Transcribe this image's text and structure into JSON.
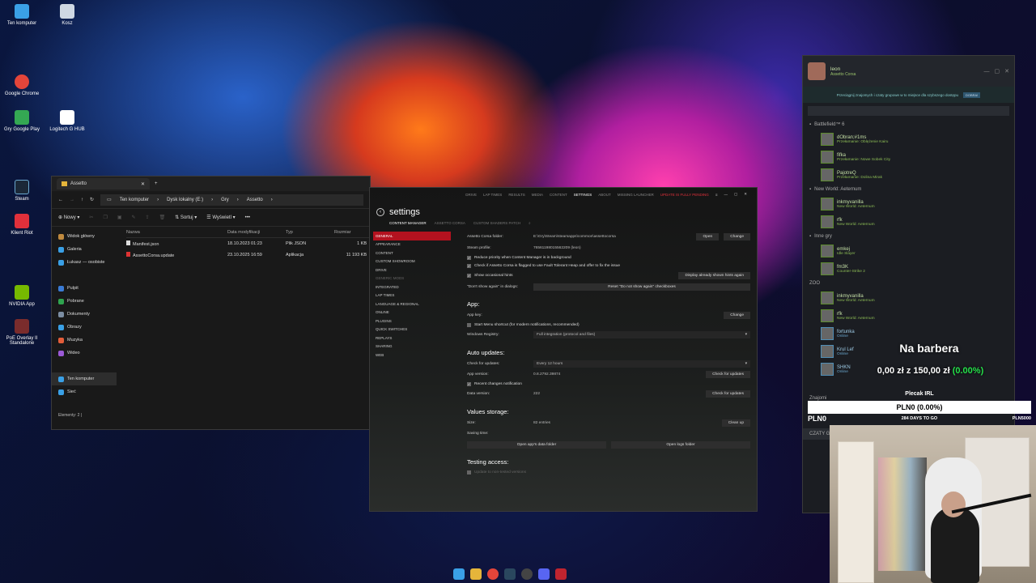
{
  "desktop": {
    "icons": [
      {
        "label": "Ten komputer",
        "color": "#3aa0e6"
      },
      {
        "label": "Kosz",
        "color": "#cfd8e3"
      },
      {
        "label": "Google Chrome",
        "color": "#e3453a"
      },
      {
        "label": "Gry Google Play",
        "color": "#34a853"
      },
      {
        "label": "Logitech G HUB",
        "color": "#ffffff"
      },
      {
        "label": "Steam",
        "color": "#1b2838"
      },
      {
        "label": "Klient Riot",
        "color": "#e0303b"
      },
      {
        "label": "NVIDIA App",
        "color": "#76b900"
      },
      {
        "label": "PoE Overlay II Standalone",
        "color": "#7a2c2c"
      }
    ]
  },
  "explorer": {
    "tab_title": "Assetto",
    "breadcrumbs": [
      "Ten komputer",
      "Dysk lokalny (E:)",
      "Gry",
      "Assetto"
    ],
    "toolbar": {
      "new": "Nowy",
      "sort": "Sortuj",
      "view": "Wyświetl",
      "more": "•••"
    },
    "sidebar": [
      {
        "label": "Widok główny",
        "color": "#c08a3e"
      },
      {
        "label": "Galeria",
        "color": "#3aa0e6"
      },
      {
        "label": "Łukasz — osobiste",
        "color": "#3aa0e6"
      },
      {
        "label": "",
        "color": "transparent"
      },
      {
        "label": "Pulpit",
        "color": "#3a7bd5"
      },
      {
        "label": "Pobrane",
        "color": "#2fa44f"
      },
      {
        "label": "Dokumenty",
        "color": "#7c8ea3"
      },
      {
        "label": "Obrazy",
        "color": "#3aa0e6"
      },
      {
        "label": "Muzyka",
        "color": "#e35d3a"
      },
      {
        "label": "Wideo",
        "color": "#9b59d6"
      },
      {
        "label": "",
        "color": "transparent"
      },
      {
        "label": "Ten komputer",
        "color": "#3aa0e6"
      },
      {
        "label": "Sieć",
        "color": "#3aa0e6"
      }
    ],
    "columns": [
      "Nazwa",
      "Data modyfikacji",
      "Typ",
      "Rozmiar"
    ],
    "files": [
      {
        "name": "Manifest.json",
        "date": "18.10.2023 01:23",
        "type": "Plik JSON",
        "size": "1 KB"
      },
      {
        "name": "AssettoCorsa.update",
        "date": "23.10.2025 16:59",
        "type": "Aplikacja",
        "size": "11 193 KB"
      }
    ],
    "status": "Elementy: 2  |"
  },
  "content_manager": {
    "top_menu": [
      "DRIVE",
      "LAP TIMES",
      "RESULTS",
      "MEDIA",
      "CONTENT",
      "SETTINGS",
      "ABOUT",
      "MISSING LAUNCHER",
      "UPDATE IS FULLY PENDING"
    ],
    "title": "settings",
    "sub_tabs": [
      "CONTENT MANAGER",
      "ASSETTO CORSA",
      "CUSTOM SHADERS PATCH"
    ],
    "nav": [
      "GENERAL",
      "APPEARANCE",
      "CONTENT",
      "CUSTOM SHOWROOM",
      "DRIVE",
      "GENERIC MODS",
      "INTEGRATED",
      "LAP TIMES",
      "LANGUAGE & REGIONAL",
      "ONLINE",
      "PLUGINS",
      "QUICK SWITCHES",
      "REPLAYS",
      "SHARING",
      "WEB"
    ],
    "general": {
      "folder_label": "Assetto Corsa folder:",
      "folder_value": "E:\\Gry\\Steam\\steamapps\\common\\assettocorsa",
      "open": "Open",
      "change": "Change",
      "steam_label": "Steam profile:",
      "steam_value": "76561198015562209 (leon)",
      "check1": "Reduce priority when Content Manager is in background",
      "check2": "Check if Assetto Corsa is flagged to use Fault Tolerant Heap and offer to fix the issue",
      "check3": "Show occasional hints",
      "hints_btn": "Display already shown hints again",
      "dont_show_label": "\"Don't show again\" in dialogs:",
      "reset_btn": "Reset \"Do not show again\" checkboxes"
    },
    "app": {
      "heading": "App:",
      "key_label": "App key:",
      "change": "Change",
      "start_menu": "Start Menu shortcut (for modern notifications, recommended)",
      "registry_label": "Windows Registry:",
      "registry_value": "Full integration (protocol and files)"
    },
    "updates": {
      "heading": "Auto updates:",
      "check_label": "Check for updates:",
      "check_value": "Every 12 hours",
      "version_label": "App version:",
      "version_value": "0.8.2792.39874",
      "check_btn": "Check for updates",
      "recent": "Recent changes notification",
      "data_label": "Data version:",
      "data_value": "222",
      "check_btn2": "Check for updates"
    },
    "storage": {
      "heading": "Values storage:",
      "size_label": "Size:",
      "size_value": "82 entries",
      "cleanup": "Clean up",
      "saving_label": "Saving time:",
      "open_data": "Open app's data folder",
      "open_logs": "Open logs folder"
    },
    "testing": {
      "heading": "Testing access:",
      "update": "Update to non-tested versions"
    }
  },
  "steam": {
    "user": "leon",
    "status": "Assetto Corsa",
    "banner": "Przeciągnij znajomych i czaty grupowe w to miejsce dla szybszego dostępu",
    "banner_btn": "DOBRA!",
    "groups": [
      {
        "title": "Battlefield™ 6",
        "friends": [
          {
            "name": "dObran;#1ms",
            "sub": "Przełamanie: Oblężenie Kairu",
            "kind": "g"
          },
          {
            "name": "fifka",
            "sub": "Przełamanie: Nowe Sobek City",
            "kind": "g"
          },
          {
            "name": "PajotreQ",
            "sub": "Przełamanie: Dolina Mirak",
            "kind": "g"
          }
        ]
      },
      {
        "title": "New World: Aeternum",
        "friends": [
          {
            "name": "inkmyvanilla",
            "sub": "New World: Aeternum",
            "kind": "g"
          },
          {
            "name": "rfk",
            "sub": "New World: Aeternum",
            "kind": "g"
          }
        ]
      },
      {
        "title": "Inne gry",
        "friends": [
          {
            "name": "emkej",
            "sub": "Idle Slayer",
            "kind": "g"
          },
          {
            "name": "fm3K",
            "sub": "Counter-Strike 2",
            "kind": "g"
          }
        ]
      },
      {
        "title": "ZOO",
        "friends": [
          {
            "name": "inkmyvanilla",
            "sub": "New World: Aeternum",
            "kind": "g"
          },
          {
            "name": "rfk",
            "sub": "New World: Aeternum",
            "kind": "g"
          },
          {
            "name": "fortunka",
            "sub": "Online",
            "kind": "o"
          },
          {
            "name": "Krul Lef",
            "sub": "Online",
            "kind": "o"
          },
          {
            "name": "SHKN",
            "sub": "Online",
            "kind": "o"
          }
        ]
      }
    ],
    "more_group": "Znajomi",
    "chats": "CZATY G"
  },
  "overlay": {
    "barbera_title": "Na barbera",
    "goal_current": "0,00 zł",
    "goal_z": "z",
    "goal_target": "150,00 zł",
    "goal_pct": "(0.00%)",
    "plecak_title": "Plecak IRL",
    "plecak_bar": "PLN0 (0.00%)",
    "plecak_left": "PLN0",
    "plecak_days": "284 DAYS TO GO",
    "plecak_right": "PLN5000"
  },
  "taskbar": {
    "icons": [
      {
        "name": "windows-icon",
        "color": "#3aa0e6"
      },
      {
        "name": "explorer-icon",
        "color": "#e5b53a"
      },
      {
        "name": "chrome-icon",
        "color": "#e3453a"
      },
      {
        "name": "steam-icon",
        "color": "#2a475e"
      },
      {
        "name": "obs-icon",
        "color": "#444444"
      },
      {
        "name": "discord-icon",
        "color": "#5865f2"
      },
      {
        "name": "assetto-icon",
        "color": "#c0242f"
      }
    ]
  }
}
